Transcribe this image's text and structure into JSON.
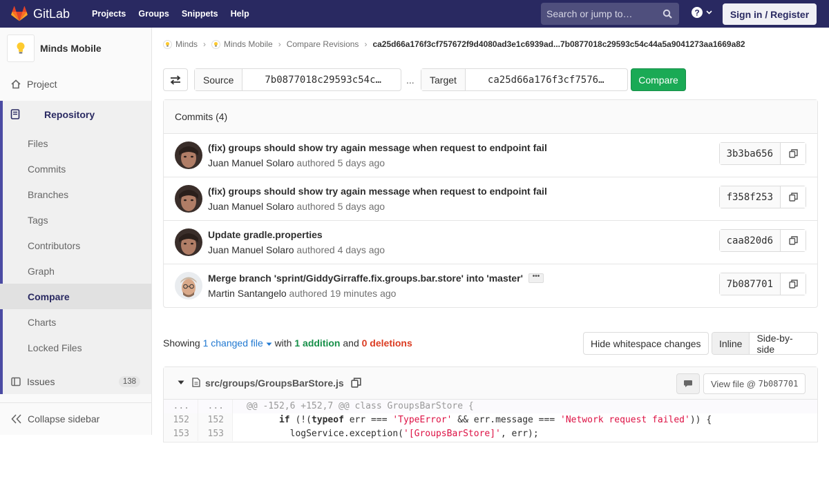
{
  "topbar": {
    "brand": "GitLab",
    "nav": [
      "Projects",
      "Groups",
      "Snippets",
      "Help"
    ],
    "search_placeholder": "Search or jump to…",
    "signin": "Sign in / Register"
  },
  "sidebar": {
    "project_name": "Minds Mobile",
    "project_item": "Project",
    "repository": "Repository",
    "repo_items": [
      "Files",
      "Commits",
      "Branches",
      "Tags",
      "Contributors",
      "Graph",
      "Compare",
      "Charts",
      "Locked Files"
    ],
    "active_item": "Compare",
    "issues": "Issues",
    "issues_count": "138",
    "collapse": "Collapse sidebar"
  },
  "breadcrumb": {
    "items": [
      "Minds",
      "Minds Mobile",
      "Compare Revisions"
    ],
    "current": "ca25d66a176f3cf757672f9d4080ad3e1c6939ad...7b0877018c29593c54c44a5a9041273aa1669a82"
  },
  "compare": {
    "source_label": "Source",
    "source_value": "7b0877018c29593c54c…",
    "separator": "...",
    "target_label": "Target",
    "target_value": "ca25d66a176f3cf7576…",
    "button": "Compare"
  },
  "commits": {
    "header": "Commits (4)",
    "verb": "authored",
    "list": [
      {
        "title": "(fix) groups should show try again message when request to endpoint fail",
        "author": "Juan Manuel Solaro",
        "time": "5 days ago",
        "sha": "3b3ba656"
      },
      {
        "title": "(fix) groups should show try again message when request to endpoint fail",
        "author": "Juan Manuel Solaro",
        "time": "5 days ago",
        "sha": "f358f253"
      },
      {
        "title": "Update gradle.properties",
        "author": "Juan Manuel Solaro",
        "time": "4 days ago",
        "sha": "caa820d6"
      },
      {
        "title": "Merge branch 'sprint/GiddyGirraffe.fix.groups.bar.store' into 'master'",
        "author": "Martin Santangelo",
        "time": "19 minutes ago",
        "sha": "7b087701"
      }
    ]
  },
  "stats": {
    "showing": "Showing",
    "changed": "1 changed file",
    "with": "with",
    "additions": "1 addition",
    "and": "and",
    "deletions": "0 deletions"
  },
  "view_options": {
    "whitespace": "Hide whitespace changes",
    "inline": "Inline",
    "side_by_side": "Side-by-side"
  },
  "file": {
    "path": "src/groups/GroupsBarStore.js",
    "view_file": "View file @",
    "view_sha": "7b087701",
    "lines": [
      {
        "old": "...",
        "new": "...",
        "text": "@@ -152,6 +152,7 @@ class GroupsBarStore {"
      },
      {
        "old": "152",
        "new": "152",
        "kw1": "if",
        "p1": " (!(",
        "kw2": "typeof",
        "p2": " err === ",
        "s1": "'TypeError'",
        "p3": " && err.message === ",
        "s2": "'Network request failed'",
        "p4": ")) {"
      },
      {
        "old": "153",
        "new": "153",
        "p1": "logService.exception(",
        "s1": "'[GroupsBarStore]'",
        "p2": ", err);"
      }
    ]
  },
  "colors": {
    "navbar": "#292961",
    "accent": "#1f78d1",
    "success": "#1aaa55",
    "danger": "#db3b21"
  }
}
